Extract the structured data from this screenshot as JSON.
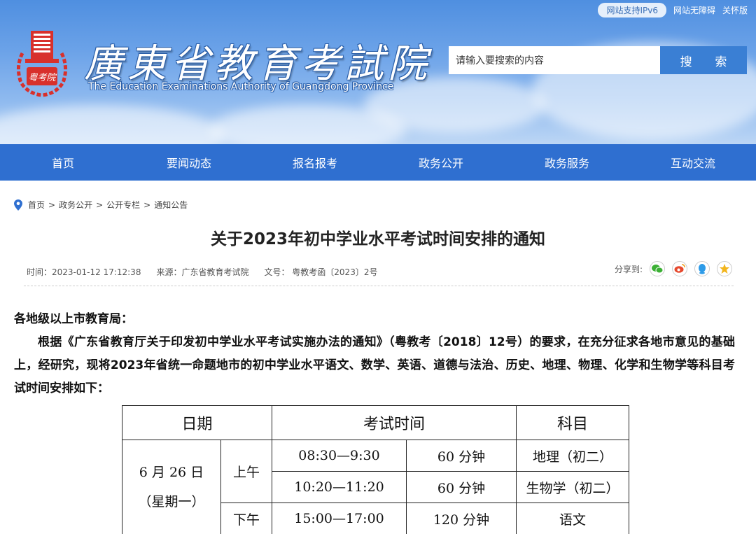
{
  "header": {
    "ipv6_badge": "网站支持IPv6",
    "accessibility_link": "网站无障碍",
    "care_link": "关怀版",
    "title_cn": "廣東省教育考試院",
    "title_en": "The Education Examinations Authority of Guangdong Province",
    "seal_text": "粤考院",
    "search_placeholder": "请输入要搜索的内容",
    "search_button": "搜 索"
  },
  "nav": {
    "items": [
      "首页",
      "要闻动态",
      "报名报考",
      "政务公开",
      "政务服务",
      "互动交流"
    ]
  },
  "breadcrumb": {
    "items": [
      "首页",
      "政务公开",
      "公开专栏",
      "通知公告"
    ],
    "separator": ">"
  },
  "article": {
    "title": "关于2023年初中学业水平考试时间安排的通知",
    "time": "时间：2023-01-12 17:12:38",
    "source": "来源：广东省教育考试院",
    "doc_no": "文号： 粤教考函〔2023〕2号",
    "share_label": "分享到:",
    "salutation": "各地级以上市教育局：",
    "paragraph": "根据《广东省教育厅关于印发初中学业水平考试实施办法的通知》（粤教考〔2018〕12号）的要求，在充分征求各地市意见的基础上，经研究，现将2023年省统一命题地市的初中学业水平语文、数学、英语、道德与法治、历史、地理、物理、化学和生物学等科目考试时间安排如下："
  },
  "table": {
    "headers": [
      "日期",
      "考试时间",
      "科目"
    ],
    "date": "6 月 26 日",
    "weekday": "（星期一）",
    "morning": "上午",
    "afternoon": "下午",
    "rows": [
      {
        "time": "08:30—9:30",
        "duration": "60 分钟",
        "subject": "地理（初二）"
      },
      {
        "time": "10:20—11:20",
        "duration": "60 分钟",
        "subject": "生物学（初二）"
      },
      {
        "time": "15:00—17:00",
        "duration": "120 分钟",
        "subject": "语文"
      }
    ]
  },
  "colors": {
    "nav_bg": "#2f6fd0",
    "search_button_bg": "#3a7fd4",
    "seal_red": "#d8302c",
    "share_wechat": "#3cb035",
    "share_weibo": "#e6492e",
    "share_qq": "#2d9be8",
    "share_qzone": "#f2b51c"
  }
}
